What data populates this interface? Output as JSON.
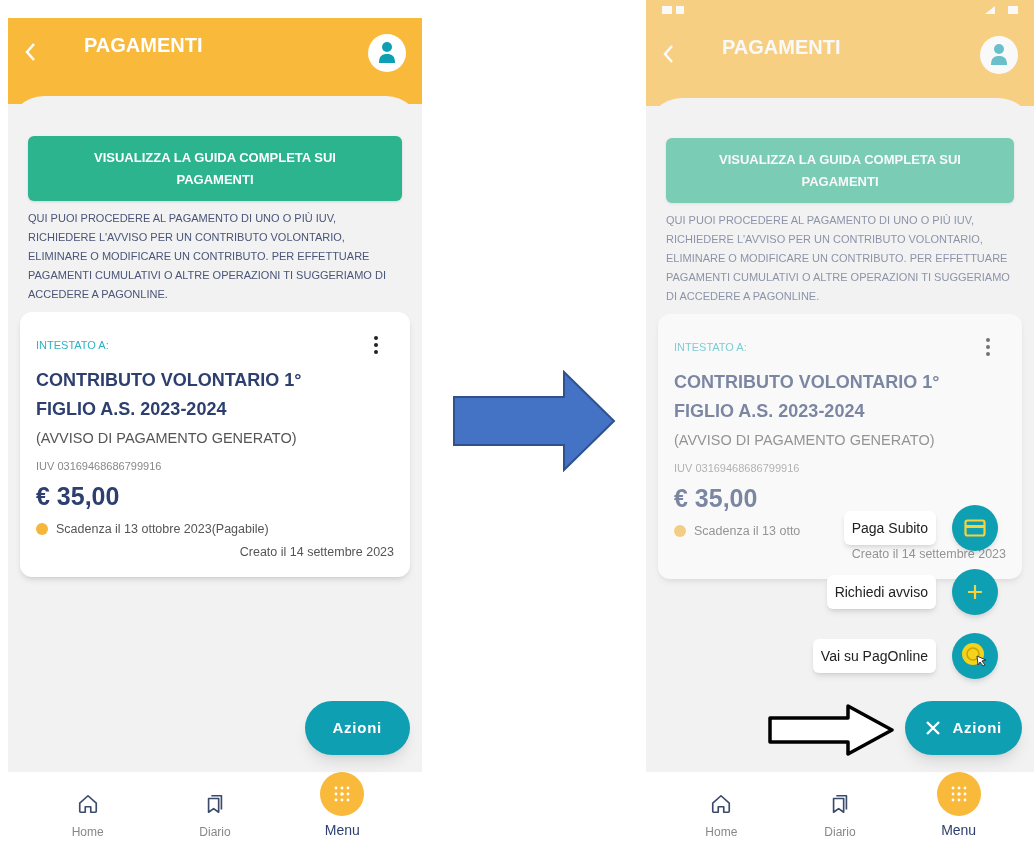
{
  "screens": [
    {
      "dimmed": false,
      "status_bar": false,
      "title": "PAGAMENTI",
      "guide_button": "VISUALIZZA LA GUIDA COMPLETA SUI PAGAMENTI",
      "description": "QUI PUOI PROCEDERE AL PAGAMENTO DI UNO O PIÙ IUV, RICHIEDERE L'AVVISO PER UN CONTRIBUTO VOLONTARIO, ELIMINARE O MODIFICARE UN CONTRIBUTO. PER EFFETTUARE PAGAMENTI CUMULATIVI O ALTRE OPERAZIONI TI SUGGERIAMO DI ACCEDERE A PAGONLINE.",
      "card": {
        "holder_label": "INTESTATO A:",
        "title": "CONTRIBUTO VOLONTARIO 1° FIGLIO A.S. 2023-2024",
        "subtitle": "(AVVISO DI PAGAMENTO GENERATO)",
        "iuv": "IUV 03169468686799916",
        "amount": "€ 35,00",
        "due": "Scadenza il 13 ottobre 2023(Pagabile)",
        "created": "Creato il 14 settembre 2023"
      },
      "action_button": {
        "label": "Azioni",
        "expanded": false
      },
      "nav": [
        {
          "label": "Home",
          "kind": "home",
          "selected": false
        },
        {
          "label": "Diario",
          "kind": "diary",
          "selected": false
        },
        {
          "label": "Menu",
          "kind": "menu",
          "selected": true
        }
      ]
    },
    {
      "dimmed": true,
      "status_bar": true,
      "title": "PAGAMENTI",
      "guide_button": "VISUALIZZA LA GUIDA COMPLETA SUI PAGAMENTI",
      "description": "QUI PUOI PROCEDERE AL PAGAMENTO DI UNO O PIÙ IUV, RICHIEDERE L'AVVISO PER UN CONTRIBUTO VOLONTARIO, ELIMINARE O MODIFICARE UN CONTRIBUTO. PER EFFETTUARE PAGAMENTI CUMULATIVI O ALTRE OPERAZIONI TI SUGGERIAMO DI ACCEDERE A PAGONLINE.",
      "card": {
        "holder_label": "INTESTATO A:",
        "title": "CONTRIBUTO VOLONTARIO 1° FIGLIO A.S. 2023-2024",
        "subtitle": "(AVVISO DI PAGAMENTO GENERATO)",
        "iuv": "IUV 03169468686799916",
        "amount": "€ 35,00",
        "due": "Scadenza il 13 otto",
        "created": "Creato il 14 settembre 2023"
      },
      "action_button": {
        "label": "Azioni",
        "expanded": true
      },
      "action_menu": [
        {
          "label": "Paga Subito",
          "kind": "card"
        },
        {
          "label": "Richiedi avviso",
          "kind": "plus"
        },
        {
          "label": "Vai su PagOnline",
          "kind": "pointer"
        }
      ],
      "nav": [
        {
          "label": "Home",
          "kind": "home",
          "selected": false
        },
        {
          "label": "Diario",
          "kind": "diary",
          "selected": false
        },
        {
          "label": "Menu",
          "kind": "menu",
          "selected": true
        }
      ]
    }
  ]
}
